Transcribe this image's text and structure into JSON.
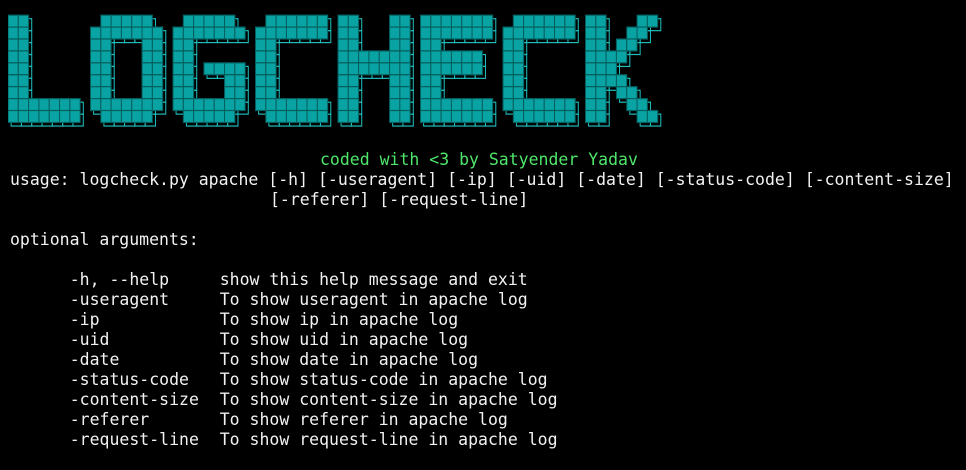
{
  "banner": {
    "text": "LOGCHECK",
    "fill_color": "#0aa3a3",
    "outline_color": "#1fbcbc"
  },
  "tagline": "coded with <3 by Satyender Yadav",
  "usage": {
    "line1": "usage: logcheck.py apache [-h] [-useragent] [-ip] [-uid] [-date] [-status-code] [-content-size]",
    "line2": "[-referer] [-request-line]"
  },
  "optional_header": "optional arguments:",
  "arguments": [
    {
      "flag": "-h, --help",
      "desc": "show this help message and exit"
    },
    {
      "flag": "-useragent",
      "desc": "To show useragent in apache log"
    },
    {
      "flag": "-ip",
      "desc": "To show ip in apache log"
    },
    {
      "flag": "-uid",
      "desc": "To show uid in apache log"
    },
    {
      "flag": "-date",
      "desc": "To show date in apache log"
    },
    {
      "flag": "-status-code",
      "desc": "To show status-code in apache log"
    },
    {
      "flag": "-content-size",
      "desc": "To show content-size in apache log"
    },
    {
      "flag": "-referer",
      "desc": "To show referer in apache log"
    },
    {
      "flag": "-request-line",
      "desc": "To show request-line in apache log"
    }
  ],
  "colors": {
    "background": "#000000",
    "text": "#f2f2f2",
    "tagline": "#4ee66a"
  }
}
